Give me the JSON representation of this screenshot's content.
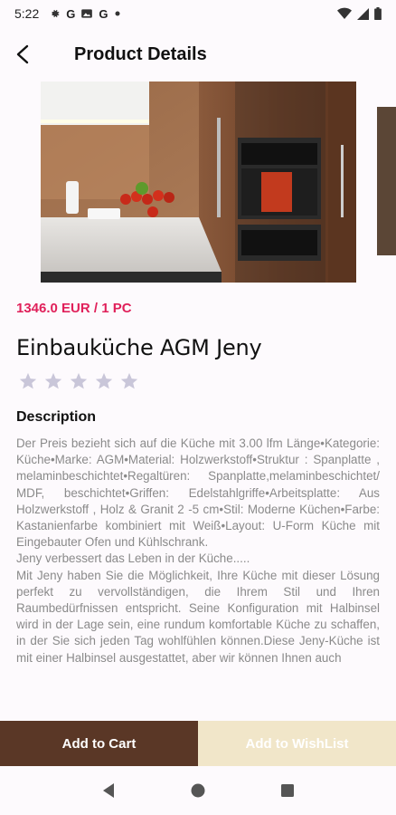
{
  "status_bar": {
    "time": "5:22",
    "left_icons": [
      "gear-icon",
      "google-g-icon",
      "image-icon",
      "google-g-icon",
      "dot-icon"
    ],
    "right_icons": [
      "wifi-icon",
      "signal-icon",
      "battery-icon"
    ]
  },
  "app_bar": {
    "title": "Product Details"
  },
  "product": {
    "price": "1346.0 EUR / 1 PC",
    "name": "Einbauküche AGM Jeny",
    "rating": 0,
    "rating_max": 5,
    "star_color": "#c9c6d9"
  },
  "description": {
    "heading": "Description",
    "paragraph1": "Der Preis bezieht sich auf die Küche mit 3.00 lfm Länge•Kategorie: Küche•Marke: AGM•Material: Holzwerkstoff•Struktur : Spanplatte , melaminbeschichtet•Regaltüren: Spanplatte,melaminbeschichtet/ MDF, beschichtet•Griffen: Edelstahlgriffe•Arbeitsplatte: Aus Holzwerkstoff , Holz & Granit 2 -5 cm•Stil: Moderne Küchen•Farbe: Kastanienfarbe kombiniert mit Weiß•Layout: U-Form Küche mit Eingebauter Ofen und Kühlschrank.",
    "paragraph2": "Jeny verbessert das Leben in der Küche.....",
    "paragraph3": "Mit Jeny haben Sie die Möglichkeit, Ihre Küche mit dieser Lösung perfekt zu vervollständigen, die Ihrem Stil und Ihren Raumbedürfnissen entspricht. Seine Konfiguration mit Halbinsel wird in der Lage sein, eine rundum komfortable Küche zu schaffen, in der Sie sich jeden Tag wohlfühlen können.Diese Jeny-Küche ist mit einer Halbinsel ausgestattet, aber wir können Ihnen auch"
  },
  "actions": {
    "add_to_cart": "Add to Cart",
    "add_to_wishlist": "Add to WishList"
  },
  "colors": {
    "price": "#e0205a",
    "cart_button": "#5a3726",
    "wishlist_button": "#f1e6c9"
  }
}
